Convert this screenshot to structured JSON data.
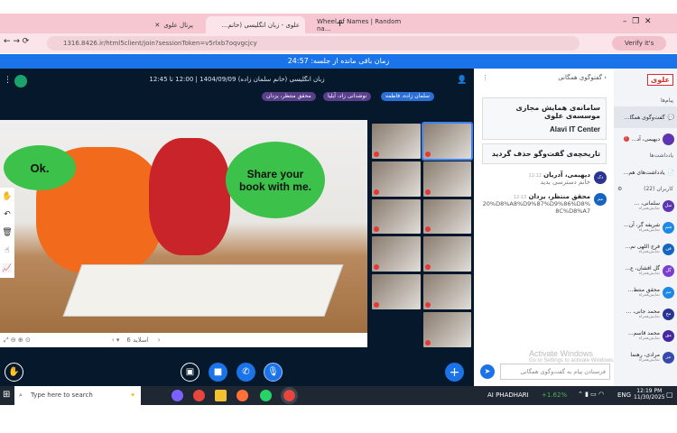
{
  "browser": {
    "tabs": [
      "پرتال علوی",
      "علوی - زبان انگلیسی (خانم...",
      "Wheel of Names | Random na..."
    ],
    "url": "1316.8426.ir/html5client/join?sessionToken=v5rlxb7oqvgcjcy",
    "profile": "Verify it's you"
  },
  "banner": "زمان باقی مانده از جلسه: 24:57",
  "meeting": {
    "title": "زبان انگلیسی (خانم سلمان زاده) 1404/09/09 | 12:00 تا 12:45",
    "chips": [
      "سلمان زاده، فاطمه",
      "نوشدانی زاد، آیلیا",
      "محقق منتظر، یزدان"
    ],
    "slide": {
      "bubble_left": "Ok.",
      "bubble_right": "Share your book with me.",
      "slide_label": "اسلاید 6"
    }
  },
  "chat": {
    "header": "گفتوگوی همگانی",
    "welcome": "سامانه‌ی همایش مجازی موسسه‌ی علوی",
    "welcome_en": "Alavi IT Center",
    "cleared": "تاریخچه‌ی گفت‌وگو حذف گردید",
    "messages": [
      {
        "initials": "دک",
        "name": "دیهیمی، آدریان",
        "time": "12:12",
        "text": "خانم دسترسی بدید"
      },
      {
        "initials": "مم",
        "name": "محقق منتظر، یزدان",
        "time": "12:13",
        "text": "20%D8%A8%D9%87%D9%86%D8%8C%D8%A7"
      }
    ],
    "input_placeholder": "فرستادن پیام به گفت‌وگوی همگانی"
  },
  "sidebar": {
    "logo": "علوی",
    "messages_label": "پیام‌ها",
    "public_chat": "گفت‌وگوی همگا...",
    "private_chat": "دیهیمی، آد...",
    "notes_label": "یادداشت‌ها",
    "shared_notes": "یادداشت‌های هم...",
    "users_label": "کاربران (22)",
    "users": [
      {
        "i": "سل",
        "n": "سلمانی، ...",
        "s": "نمایش‌همراه"
      },
      {
        "i": "شم",
        "n": "شریفه گر، آن...",
        "s": "نمایش‌همراه"
      },
      {
        "i": "فن",
        "n": "فرج اللهی نم...",
        "s": "نمایش‌همراه"
      },
      {
        "i": "گل",
        "n": "گل افشان، ع...",
        "s": "نمایش‌همراه"
      },
      {
        "i": "مم",
        "n": "محقق منتظ...",
        "s": "نمایش‌همراه"
      },
      {
        "i": "مج",
        "n": "محمد جانی، ...",
        "s": "نمایش‌همراه"
      },
      {
        "i": "مق",
        "n": "محمد قاسم...",
        "s": "نمایش‌همراه"
      },
      {
        "i": "مر",
        "n": "مرادی، رهنما",
        "s": "نمایش‌همراه"
      }
    ]
  },
  "watermark": {
    "line1": "Activate Windows",
    "line2": "Go to Settings to activate Windows."
  },
  "taskbar": {
    "search": "Type here to search",
    "stock": "AI PHADHARI",
    "change": "+1.62%",
    "lang": "ENG",
    "time": "12:19 PM",
    "date": "11/30/2025"
  }
}
